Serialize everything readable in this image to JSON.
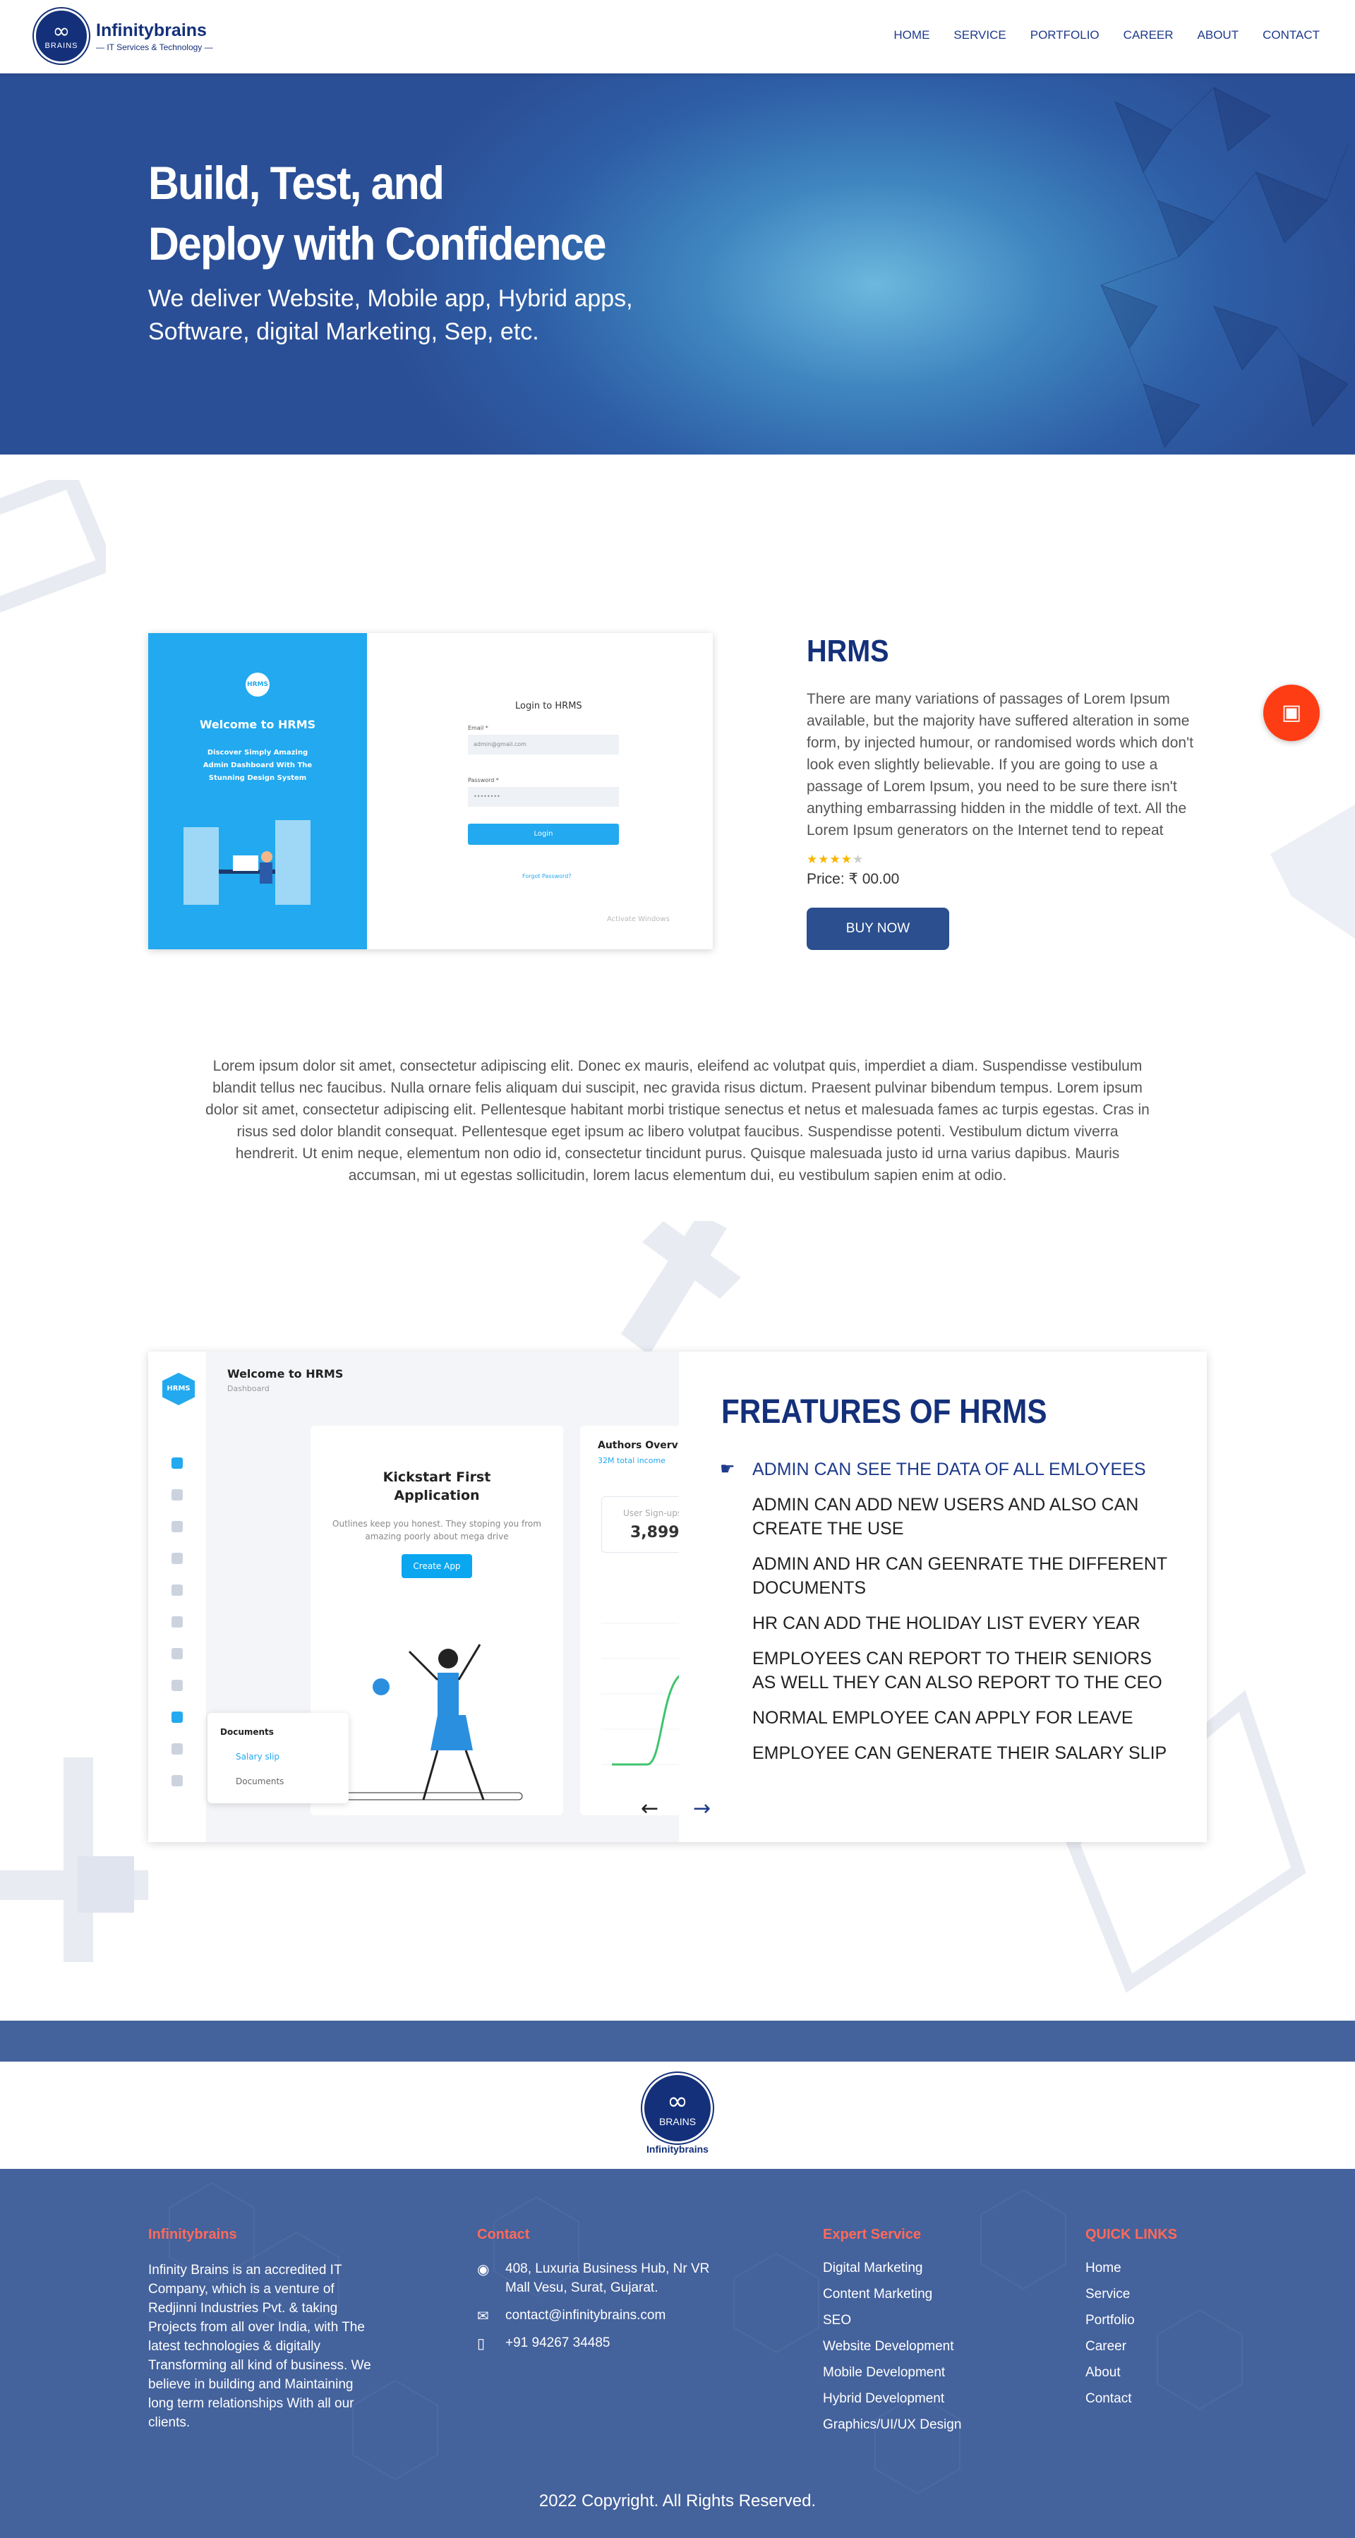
{
  "brand": {
    "name": "Infinitybrains",
    "tagline": "— IT Services & Technology —",
    "logo_glyph": "∞",
    "logo_word": "BRAINS"
  },
  "nav": [
    "HOME",
    "SERVICE",
    "PORTFOLIO",
    "CAREER",
    "ABOUT",
    "CONTACT"
  ],
  "hero": {
    "title_line1": "Build, Test, and",
    "title_line2": "Deploy with Confidence",
    "subtitle": "We deliver Website, Mobile app, Hybrid apps, Software, digital Marketing, Sep, etc."
  },
  "product": {
    "title": "HRMS",
    "description": "There are many variations of passages of Lorem Ipsum available, but the majority have suffered alteration in some form, by injected humour, or randomised words which don't look even slightly believable. If you are going to use a passage of Lorem Ipsum, you need to be sure there isn't anything embarrassing hidden in the middle of text. All the Lorem Ipsum generators on the Internet tend to repeat predefined chunks as necessary.",
    "rating": 4,
    "rating_max": 5,
    "price": "Price: ₹ 00.00",
    "buy_label": "BUY NOW",
    "screenshot": {
      "logo": "HRMS",
      "welcome": "Welcome to HRMS",
      "subtitle": "Discover Simply Amazing Admin Dashboard With The Stunning Design System",
      "login_title": "Login to HRMS",
      "email_label": "Email *",
      "email_value": "admin@gmail.com",
      "password_label": "Password *",
      "password_value": "••••••••",
      "login_button": "Login",
      "forgot": "Forgot Password?",
      "watermark": "Activate Windows"
    }
  },
  "body_text": "Lorem ipsum dolor sit amet, consectetur adipiscing elit. Donec ex mauris, eleifend ac volutpat quis, imperdiet a diam. Suspendisse vestibulum blandit tellus nec faucibus. Nulla ornare felis aliquam dui suscipit, nec gravida risus dictum. Praesent pulvinar bibendum tempus. Lorem ipsum dolor sit amet, consectetur adipiscing elit. Pellentesque habitant morbi tristique senectus et netus et malesuada fames ac turpis egestas. Cras in risus sed dolor blandit consequat. Pellentesque eget ipsum ac libero volutpat faucibus. Suspendisse potenti. Vestibulum dictum viverra hendrerit. Ut enim neque, elementum non odio id, consectetur tincidunt purus. Quisque malesuada justo id urna varius dapibus. Mauris accumsan, mi ut egestas sollicitudin, lorem lacus elementum dui, eu vestibulum sapien enim at odio.",
  "features": {
    "title": "FREATURES OF HRMS",
    "items": [
      "ADMIN CAN SEE THE DATA OF ALL EMLOYEES",
      "ADMIN CAN ADD NEW USERS AND ALSO CAN CREATE THE USE",
      "ADMIN AND HR CAN GEENRATE THE DIFFERENT DOCUMENTS",
      "HR CAN ADD THE HOLIDAY LIST EVERY YEAR",
      "EMPLOYEES CAN REPORT TO THEIR SENIORS AS WELL THEY CAN ALSO REPORT TO THE CEO",
      "NORMAL EMPLOYEE CAN APPLY FOR LEAVE",
      "EMPLOYEE CAN GENERATE THEIR SALARY SLIP"
    ],
    "prev": "←",
    "next": "→",
    "dashboard": {
      "logo": "HRMS",
      "welcome": "Welcome to HRMS",
      "breadcrumb": "Dashboard",
      "kick_title": "Kickstart First Application",
      "kick_desc": "Outlines keep you honest. They stoping you from amazing poorly about mega drive",
      "kick_button": "Create App",
      "authors_title": "Authors Overview",
      "authors_sub": "32M total income",
      "signups_label": "User Sign-ups",
      "signups_value": "3,899",
      "docs_title": "Documents",
      "docs_item1": "Salary slip",
      "docs_item2": "Documents",
      "tooltip": "Salary slip"
    }
  },
  "footer": {
    "brand_word": "Infinitybrains",
    "about_title": "Infinitybrains",
    "about_text": "Infinity Brains is an accredited IT Company, which is a venture of Redjinni Industries Pvt. & taking Projects from all over India, with The latest technologies & digitally Transforming all kind of business. We believe in building and Maintaining long term relationships With all our clients.",
    "contact_title": "Contact",
    "address": "408, Luxuria Business Hub, Nr VR Mall Vesu, Surat, Gujarat.",
    "email": "contact@infinitybrains.com",
    "phone": "+91 94267 34485",
    "services_title": "Expert Service",
    "services": [
      "Digital Marketing",
      "Content Marketing",
      "SEO",
      "Website Development",
      "Mobile Development",
      "Hybrid Development",
      "Graphics/UI/UX Design"
    ],
    "links_title": "QUICK LINKS",
    "links": [
      "Home",
      "Service",
      "Portfolio",
      "Career",
      "About",
      "Contact"
    ],
    "copyright": "2022 Copyright. All Rights Reserved."
  },
  "colors": {
    "primary": "#14307a",
    "accent": "#ff3d14",
    "footer": "#44629c",
    "heading_accent": "#ff6a5a",
    "button": "#2b4f8f"
  }
}
